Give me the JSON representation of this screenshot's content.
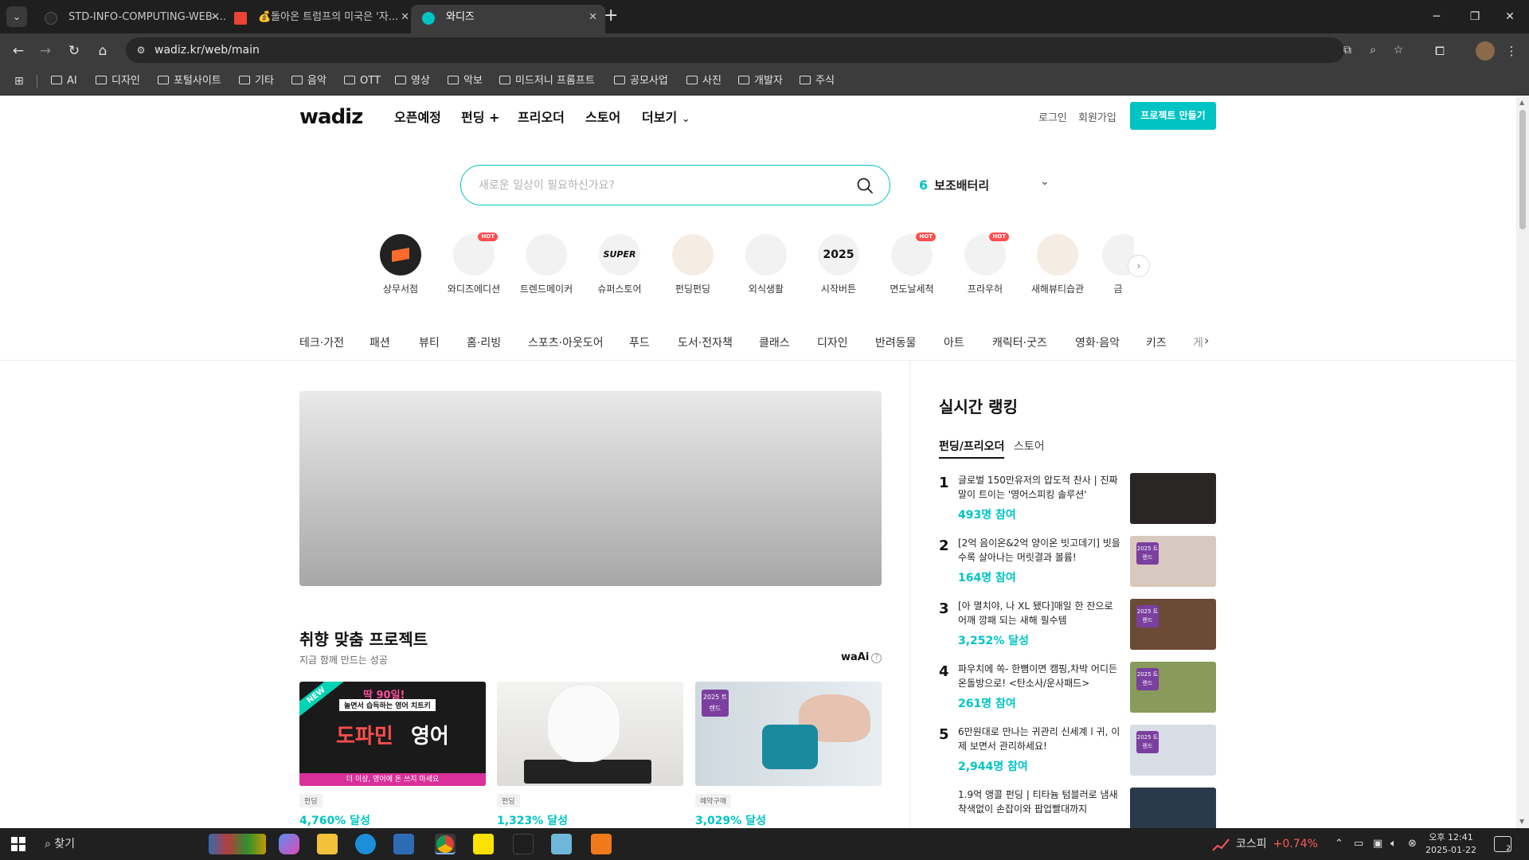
{
  "browser": {
    "tabs": [
      {
        "title": "STD-INFO-COMPUTING-WEB-...",
        "active": false
      },
      {
        "title": "💰돌아온 트럼프의 미국은 '자...",
        "active": false
      },
      {
        "title": "와디즈",
        "active": true
      }
    ],
    "url": "wadiz.kr/web/main",
    "bookmarks": [
      "AI",
      "디자인",
      "포털사이트",
      "기타",
      "음악",
      "OTT",
      "영상",
      "악보",
      "미드저니 프롬프트",
      "공모사업",
      "사진",
      "개발자",
      "주식"
    ]
  },
  "header": {
    "logo": "wadiz",
    "nav": [
      "오픈예정",
      "펀딩 +",
      "프리오더",
      "스토어",
      "더보기"
    ],
    "login": "로그인",
    "signup": "회원가입",
    "cta": "프로젝트 만들기"
  },
  "search": {
    "placeholder": "새로운 일상이 필요하신가요?",
    "rank_number": "6",
    "rank_keyword": "보조배터리"
  },
  "categories": [
    {
      "label": "상무서점",
      "hot": false,
      "text": ""
    },
    {
      "label": "와디즈에디션",
      "hot": true,
      "text": ""
    },
    {
      "label": "트렌드메이커",
      "hot": false,
      "text": ""
    },
    {
      "label": "슈퍼스토어",
      "hot": false,
      "text": "SUPER"
    },
    {
      "label": "펀딩펀딩",
      "hot": false,
      "text": ""
    },
    {
      "label": "외식생활",
      "hot": false,
      "text": ""
    },
    {
      "label": "시작버튼",
      "hot": false,
      "text": "2025"
    },
    {
      "label": "면도날세척",
      "hot": true,
      "text": ""
    },
    {
      "label": "프라우허",
      "hot": true,
      "text": ""
    },
    {
      "label": "새해뷰티습관",
      "hot": false,
      "text": ""
    },
    {
      "label": "금",
      "hot": false,
      "text": ""
    }
  ],
  "hot_label": "HOT",
  "category_tabs": [
    "테크·가전",
    "패션",
    "뷰티",
    "홈·리빙",
    "스포츠·아웃도어",
    "푸드",
    "도서·전자책",
    "클래스",
    "디자인",
    "반려동물",
    "아트",
    "캐릭터·굿즈",
    "영화·음악",
    "키즈",
    "게"
  ],
  "recommend": {
    "title": "취향 맞춤 프로젝트",
    "subtitle": "지금 함께 만드는 성공",
    "brand": "waAi",
    "cards": [
      {
        "tag": "펀딩",
        "achieved": "4,760% 달성",
        "img_text": {
          "new": "NEW",
          "headline": "딱 90일!",
          "sub": "놀면서 습득하는 영어 치트키",
          "big1": "도파민",
          "big2": "영어",
          "band": "더 이상, 영어에 돈 쓰지 마세요"
        }
      },
      {
        "tag": "펀딩",
        "achieved": "1,323% 달성"
      },
      {
        "tag": "예약구매",
        "achieved": "3,029% 달성",
        "badge": "2025 트렌드"
      }
    ]
  },
  "ranking": {
    "title": "실시간 랭킹",
    "tabs": [
      "펀딩/프리오더",
      "스토어"
    ],
    "items": [
      {
        "rank": "1",
        "title": "글로벌 150만유저의 압도적 찬사 | 진짜 말이 트이는 '영어스피킹 솔루션'",
        "stat": "493명 참여",
        "badge": "",
        "color": "#2b2626"
      },
      {
        "rank": "2",
        "title": "[2억 음이온&2억 양이온 빗고데기] 빗을수록 살아나는 머릿결과 볼륨!",
        "stat": "164명 참여",
        "badge": "2025 트렌드",
        "color": "#d8c9c0"
      },
      {
        "rank": "3",
        "title": "[아 멸치야, 나 XL 됐다]매일 한 잔으로 어깨 깡패 되는 새해 필수템",
        "stat": "3,252% 달성",
        "badge": "2025 트렌드",
        "color": "#6b4a36"
      },
      {
        "rank": "4",
        "title": "파우치에 쏙- 한뼘이면 캠핑,차박 어디든 온돌방으로! <탄소사/운사패드>",
        "stat": "261명 참여",
        "badge": "2025 트렌드",
        "color": "#8a9a5a"
      },
      {
        "rank": "5",
        "title": "6만원대로 만나는 귀관리 신세계 l 귀, 이제 보면서 관리하세요!",
        "stat": "2,944명 참여",
        "badge": "2025 트렌드",
        "color": "#d9dde6"
      },
      {
        "rank": "",
        "title": "1.9억 앵콜 펀딩 | 티타늄 텀블러로 냄새 착색없이 손잡이와 팝업빨대까지",
        "stat": "",
        "badge": "",
        "color": "#2a3a4a"
      }
    ]
  },
  "taskbar": {
    "search": "찾기",
    "stock_name": "코스피",
    "stock_change": "+0.74%",
    "time": "오후 12:41",
    "date": "2025-01-22",
    "notifications": "2"
  }
}
